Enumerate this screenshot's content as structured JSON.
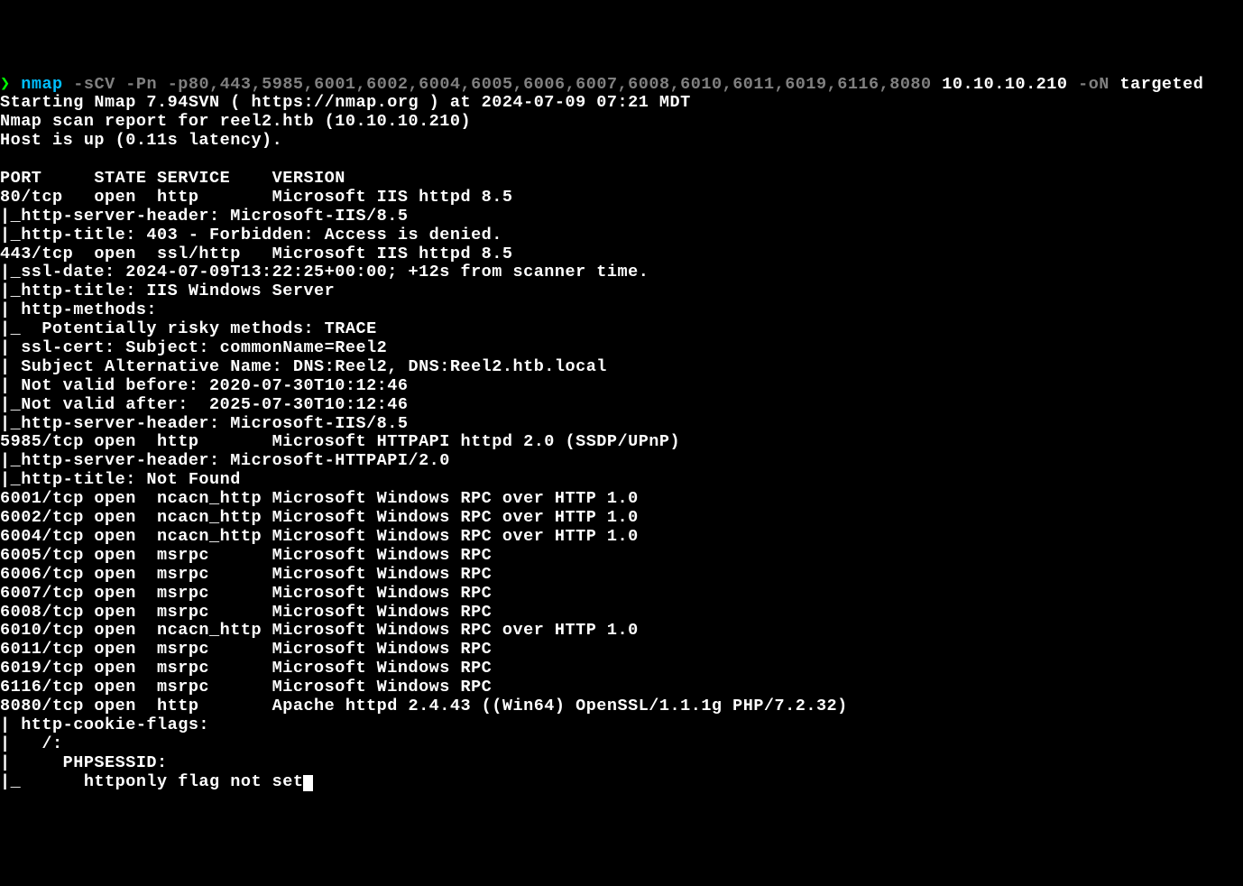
{
  "prompt": {
    "marker": "❯",
    "command": "nmap",
    "options": "-sCV -Pn -p80,443,5985,6001,6002,6004,6005,6006,6007,6008,6010,6011,6019,6116,8080",
    "target": "10.10.10.210",
    "output_flag": "-oN",
    "output_file": "targeted"
  },
  "lines": {
    "l1": "Starting Nmap 7.94SVN ( https://nmap.org ) at 2024-07-09 07:21 MDT",
    "l2": "Nmap scan report for reel2.htb (10.10.10.210)",
    "l3": "Host is up (0.11s latency).",
    "l4": "",
    "l5": "PORT     STATE SERVICE    VERSION",
    "l6": "80/tcp   open  http       Microsoft IIS httpd 8.5",
    "l7": "|_http-server-header: Microsoft-IIS/8.5",
    "l8": "|_http-title: 403 - Forbidden: Access is denied.",
    "l9": "443/tcp  open  ssl/http   Microsoft IIS httpd 8.5",
    "l10": "|_ssl-date: 2024-07-09T13:22:25+00:00; +12s from scanner time.",
    "l11": "|_http-title: IIS Windows Server",
    "l12": "| http-methods: ",
    "l13": "|_  Potentially risky methods: TRACE",
    "l14": "| ssl-cert: Subject: commonName=Reel2",
    "l15": "| Subject Alternative Name: DNS:Reel2, DNS:Reel2.htb.local",
    "l16": "| Not valid before: 2020-07-30T10:12:46",
    "l17": "|_Not valid after:  2025-07-30T10:12:46",
    "l18": "|_http-server-header: Microsoft-IIS/8.5",
    "l19": "5985/tcp open  http       Microsoft HTTPAPI httpd 2.0 (SSDP/UPnP)",
    "l20": "|_http-server-header: Microsoft-HTTPAPI/2.0",
    "l21": "|_http-title: Not Found",
    "l22": "6001/tcp open  ncacn_http Microsoft Windows RPC over HTTP 1.0",
    "l23": "6002/tcp open  ncacn_http Microsoft Windows RPC over HTTP 1.0",
    "l24": "6004/tcp open  ncacn_http Microsoft Windows RPC over HTTP 1.0",
    "l25": "6005/tcp open  msrpc      Microsoft Windows RPC",
    "l26": "6006/tcp open  msrpc      Microsoft Windows RPC",
    "l27": "6007/tcp open  msrpc      Microsoft Windows RPC",
    "l28": "6008/tcp open  msrpc      Microsoft Windows RPC",
    "l29": "6010/tcp open  ncacn_http Microsoft Windows RPC over HTTP 1.0",
    "l30": "6011/tcp open  msrpc      Microsoft Windows RPC",
    "l31": "6019/tcp open  msrpc      Microsoft Windows RPC",
    "l32": "6116/tcp open  msrpc      Microsoft Windows RPC",
    "l33": "8080/tcp open  http       Apache httpd 2.4.43 ((Win64) OpenSSL/1.1.1g PHP/7.2.32)",
    "l34": "| http-cookie-flags: ",
    "l35": "|   /: ",
    "l36": "|     PHPSESSID: ",
    "l37": "|_      httponly flag not set"
  }
}
